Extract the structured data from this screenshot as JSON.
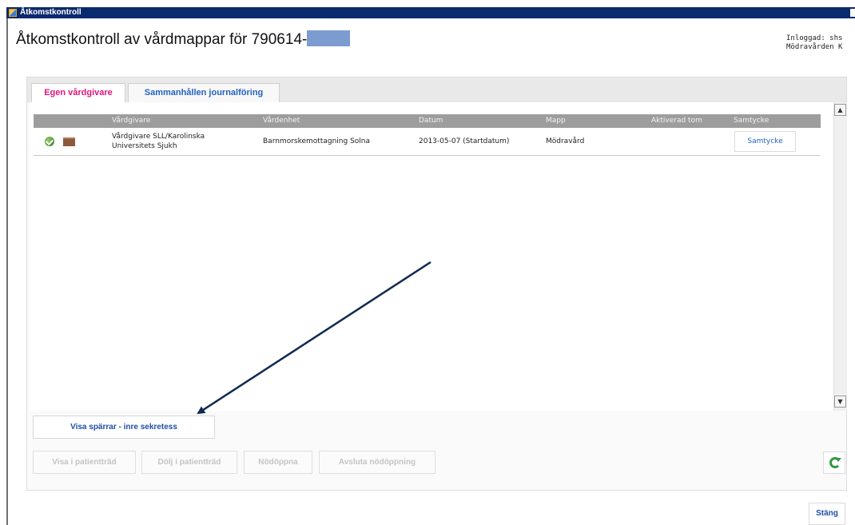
{
  "window": {
    "title": "Åtkomstkontroll"
  },
  "page": {
    "title": "Åtkomstkontroll av vårdmappar för 790614-",
    "login_line1": "Inloggad: shs",
    "login_line2": "Mödravården K"
  },
  "tabs": [
    {
      "label": "Egen vårdgivare",
      "active": true
    },
    {
      "label": "Sammanhållen journalföring",
      "active": false
    }
  ],
  "grid": {
    "columns": [
      "Vårdgivare",
      "Vårdenhet",
      "Datum",
      "Mapp",
      "Aktiverad tom",
      "Samtycke"
    ],
    "rows": [
      {
        "caregiver_line1": "Vårdgivare SLL/Karolinska",
        "caregiver_line2": "Universitets Sjukh",
        "unit": "Barnmorskemottagning Solna",
        "date": "2013-05-07 (Startdatum)",
        "folder": "Mödravård",
        "active_until": "",
        "consent_button": "Samtycke"
      }
    ]
  },
  "buttons": {
    "show_locks": "Visa spärrar - inre sekretess",
    "show_in_tree": "Visa i patientträd",
    "hide_in_tree": "Dölj i patientträd",
    "emergency_open": "Nödöppna",
    "end_emergency": "Avsluta nödöppning",
    "close": "Stäng"
  },
  "colors": {
    "titlebar": "#0a2a6e",
    "active_tab": "#e0157b",
    "link_blue": "#2361c4",
    "header_gray": "#9d9d9d",
    "arrow": "#0f2a4f",
    "refresh_green": "#2e9a3e"
  },
  "icons": [
    "ok-icon",
    "folder-icon",
    "refresh-icon",
    "scroll-up-icon",
    "scroll-down-icon"
  ]
}
